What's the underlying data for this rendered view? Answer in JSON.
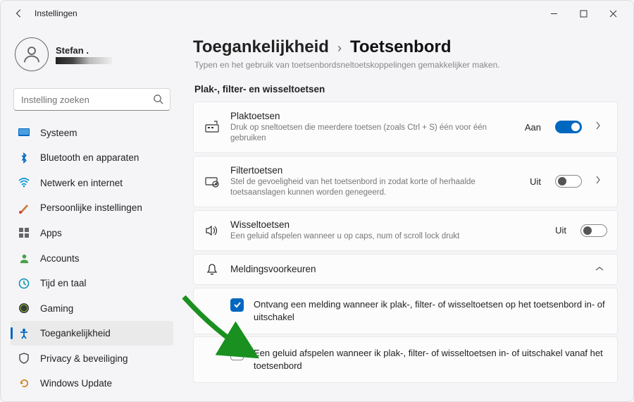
{
  "titlebar": {
    "title": "Instellingen"
  },
  "user": {
    "name": "Stefan ."
  },
  "search": {
    "placeholder": "Instelling zoeken"
  },
  "sidebar": {
    "items": [
      {
        "label": "Systeem"
      },
      {
        "label": "Bluetooth en apparaten"
      },
      {
        "label": "Netwerk en internet"
      },
      {
        "label": "Persoonlijke instellingen"
      },
      {
        "label": "Apps"
      },
      {
        "label": "Accounts"
      },
      {
        "label": "Tijd en taal"
      },
      {
        "label": "Gaming"
      },
      {
        "label": "Toegankelijkheid"
      },
      {
        "label": "Privacy & beveiliging"
      },
      {
        "label": "Windows Update"
      }
    ]
  },
  "breadcrumb": {
    "parent": "Toegankelijkheid",
    "current": "Toetsenbord"
  },
  "page": {
    "description": "Typen en het gebruik van toetsenbordsneltoetskoppelingen gemakkelijker maken.",
    "section_title": "Plak-, filter- en wisseltoetsen",
    "sticky": {
      "title": "Plaktoetsen",
      "sub": "Druk op sneltoetsen die meerdere toetsen (zoals Ctrl + S) één voor één gebruiken",
      "state": "Aan"
    },
    "filter": {
      "title": "Filtertoetsen",
      "sub": "Stel de gevoeligheid van het toetsenbord in zodat korte of herhaalde toetsaanslagen kunnen worden genegeerd.",
      "state": "Uit"
    },
    "toggle": {
      "title": "Wisseltoetsen",
      "sub": "Een geluid afspelen wanneer u op caps, num of scroll lock drukt",
      "state": "Uit"
    },
    "prefs": {
      "title": "Meldingsvoorkeuren"
    },
    "cb1": "Ontvang een melding wanneer ik plak-, filter- of wisseltoetsen op het toetsenbord in- of uitschakel",
    "cb2": "Een geluid afspelen wanneer ik plak-, filter- of wisseltoetsen in- of uitschakel vanaf het toetsenbord"
  }
}
